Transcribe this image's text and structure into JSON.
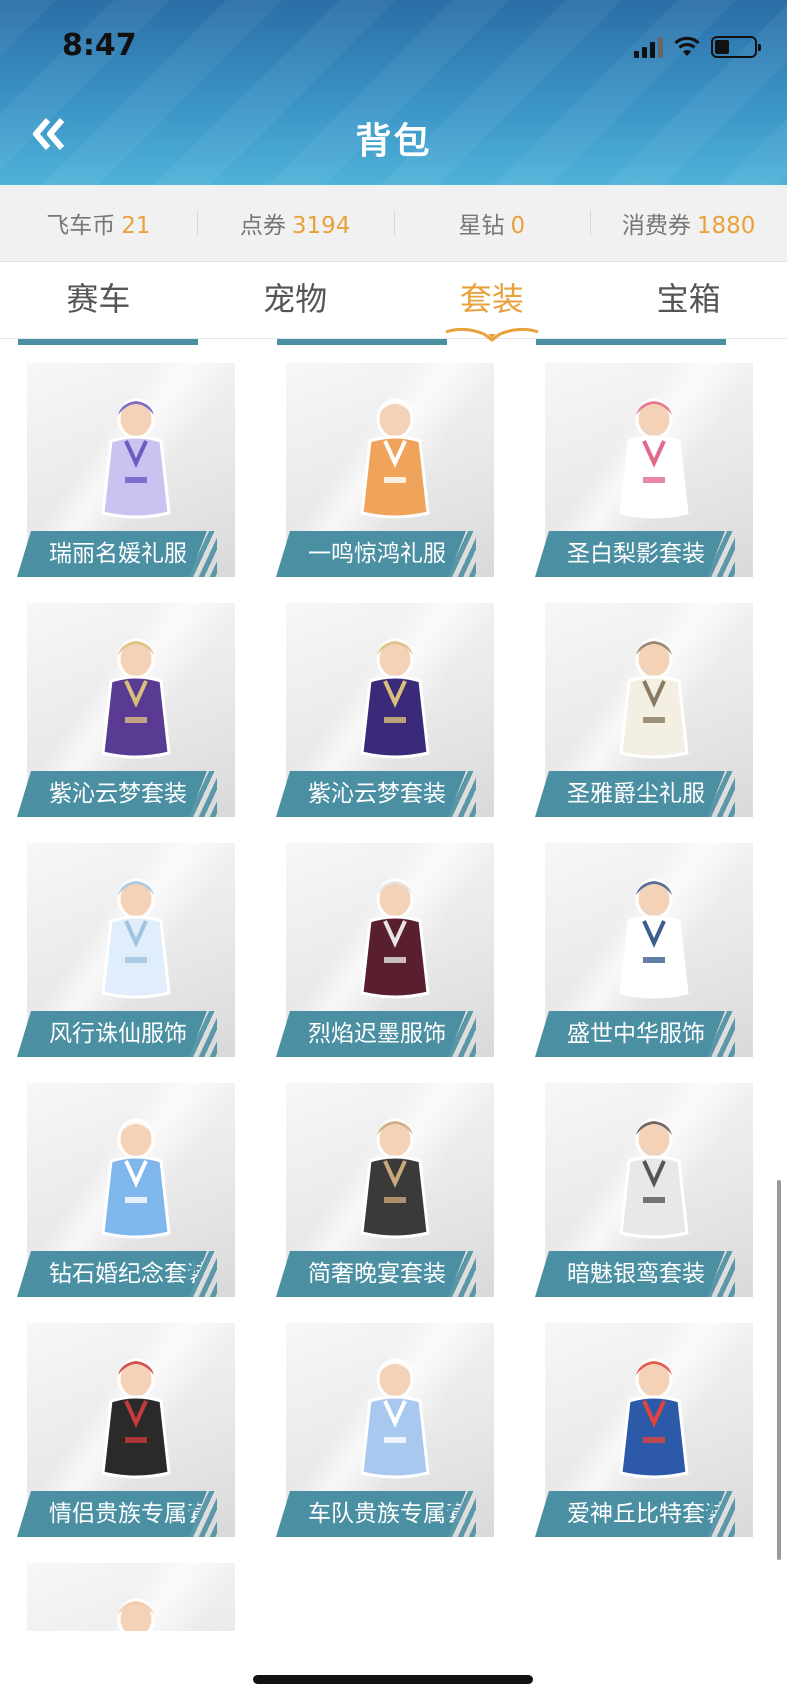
{
  "status_bar": {
    "time": "8:47"
  },
  "header": {
    "title": "背包",
    "back_icon": "double-chevron-left-icon"
  },
  "currencies": [
    {
      "label": "飞车币",
      "value": "21"
    },
    {
      "label": "点券",
      "value": "3194"
    },
    {
      "label": "星钻",
      "value": "0"
    },
    {
      "label": "消费券",
      "value": "1880"
    }
  ],
  "tabs": [
    {
      "label": "赛车",
      "active": false
    },
    {
      "label": "宠物",
      "active": false
    },
    {
      "label": "套装",
      "active": true
    },
    {
      "label": "宝箱",
      "active": false
    }
  ],
  "items": [
    {
      "name": "瑞丽名媛礼服",
      "palette": [
        "#c9c3f2",
        "#6b5bbf"
      ]
    },
    {
      "name": "一鸣惊鸿礼服",
      "palette": [
        "#f0a35a",
        "#ffffff"
      ]
    },
    {
      "name": "圣白梨影套装",
      "palette": [
        "#ffffff",
        "#e06a8a"
      ]
    },
    {
      "name": "紫沁云梦套装",
      "palette": [
        "#5a3b94",
        "#d9c07a"
      ]
    },
    {
      "name": "紫沁云梦套装",
      "palette": [
        "#3b2a7a",
        "#d9c07a"
      ]
    },
    {
      "name": "圣雅爵尘礼服",
      "palette": [
        "#f3efe2",
        "#8a7a62"
      ]
    },
    {
      "name": "风行诛仙服饰",
      "palette": [
        "#dfeefa",
        "#9fc3e0"
      ]
    },
    {
      "name": "烈焰迟墨服饰",
      "palette": [
        "#5a1f2e",
        "#e5e5e5"
      ]
    },
    {
      "name": "盛世中华服饰",
      "palette": [
        "#ffffff",
        "#3c5e8f"
      ]
    },
    {
      "name": "钻石婚纪念套装",
      "palette": [
        "#7fb6ec",
        "#ffffff"
      ]
    },
    {
      "name": "简奢晚宴套装",
      "palette": [
        "#3a3a3a",
        "#c9a87a"
      ]
    },
    {
      "name": "暗魅银鸾套装",
      "palette": [
        "#e8e8e8",
        "#555555"
      ]
    },
    {
      "name": "情侣贵族专属套装",
      "palette": [
        "#2a2a2a",
        "#c93a3a"
      ]
    },
    {
      "name": "车队贵族专属套装",
      "palette": [
        "#a9c8f0",
        "#ffffff"
      ]
    },
    {
      "name": "爱神丘比特套装",
      "palette": [
        "#2d5aa8",
        "#e0453a"
      ]
    },
    {
      "name": "",
      "palette": [
        "#c03a3a",
        "#f3c9a8"
      ]
    }
  ],
  "colors": {
    "accent": "#e8a23c",
    "label_bg": "#4b8fa3",
    "header": "#3a93c6"
  }
}
